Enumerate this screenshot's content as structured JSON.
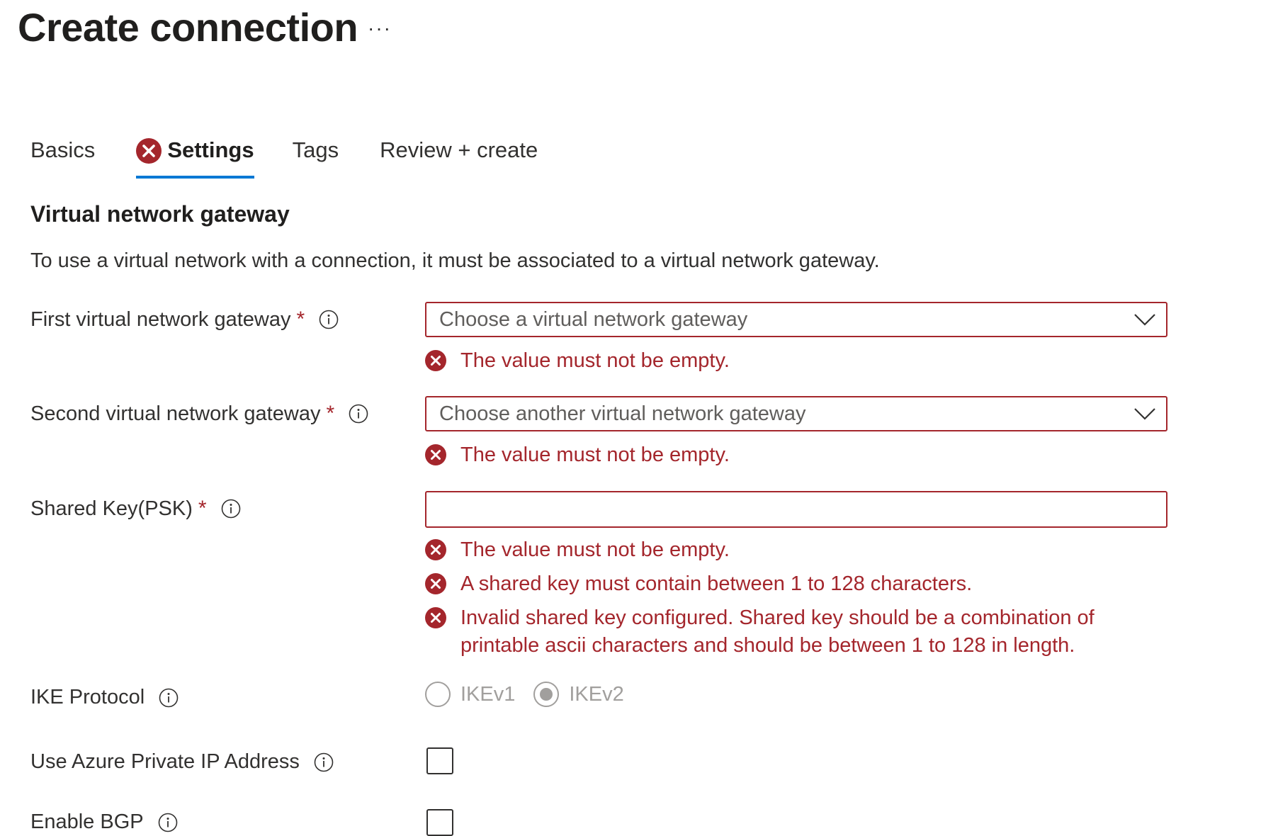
{
  "header": {
    "title": "Create connection",
    "more_label": "···"
  },
  "tabs": [
    {
      "label": "Basics"
    },
    {
      "label": "Settings",
      "has_error": true
    },
    {
      "label": "Tags"
    },
    {
      "label": "Review + create"
    }
  ],
  "section": {
    "heading": "Virtual network gateway",
    "description": "To use a virtual network with a connection, it must be associated to a virtual network gateway."
  },
  "fields": {
    "first_gateway": {
      "label": "First virtual network gateway",
      "required_mark": "*",
      "placeholder": "Choose a virtual network gateway",
      "errors": [
        "The value must not be empty."
      ]
    },
    "second_gateway": {
      "label": "Second virtual network gateway",
      "required_mark": "*",
      "placeholder": "Choose another virtual network gateway",
      "errors": [
        "The value must not be empty."
      ]
    },
    "shared_key": {
      "label": "Shared Key(PSK)",
      "required_mark": "*",
      "value": "",
      "errors": [
        "The value must not be empty.",
        "A shared key must contain between 1 to 128 characters.",
        "Invalid shared key configured. Shared key should be a combination of",
        "printable ascii characters and should be between 1 to 128 in length."
      ]
    },
    "ike_protocol": {
      "label": "IKE Protocol",
      "options": [
        "IKEv1",
        "IKEv2"
      ],
      "selected": "IKEv2",
      "disabled": true
    },
    "private_ip": {
      "label": "Use Azure Private IP Address",
      "checked": false
    },
    "enable_bgp": {
      "label": "Enable BGP",
      "checked": false
    }
  },
  "colors": {
    "error": "#a4262c",
    "accent": "#0078d4",
    "text": "#323130",
    "disabled": "#a19f9d"
  }
}
